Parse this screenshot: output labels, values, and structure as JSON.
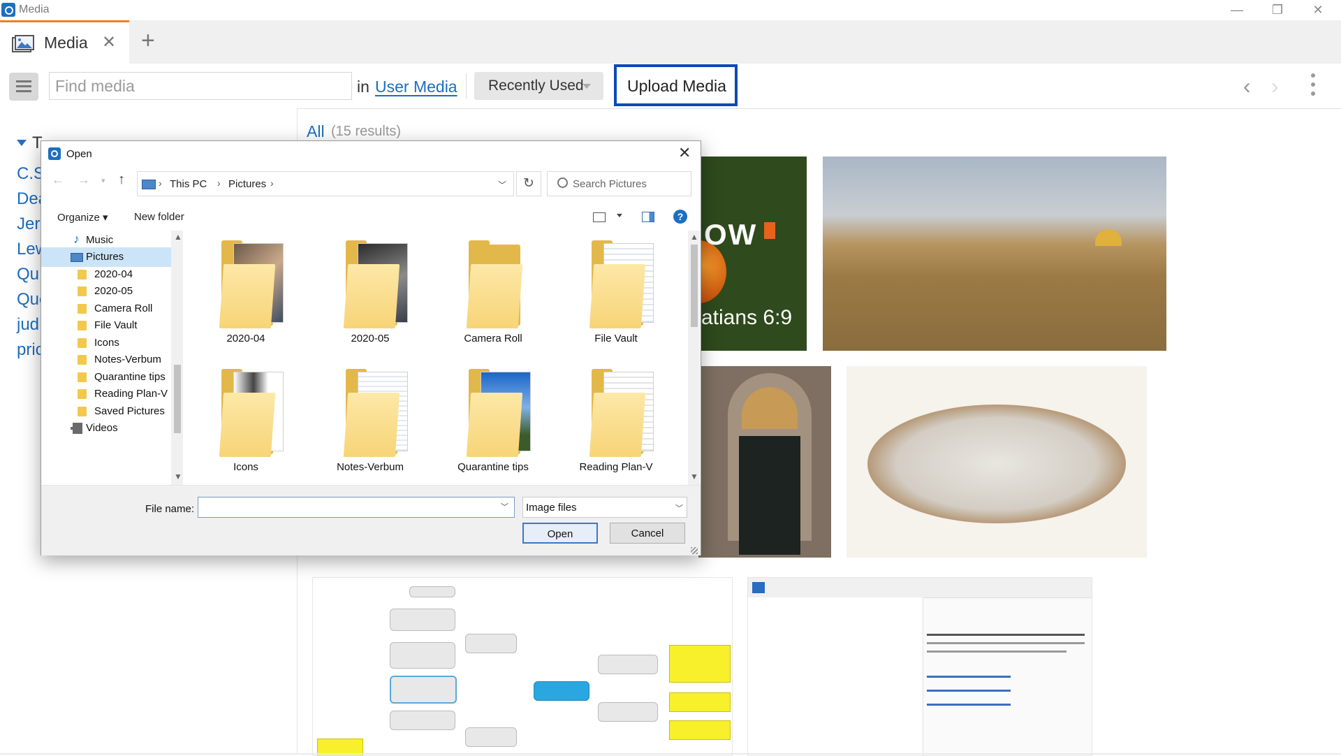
{
  "window": {
    "title": "Media",
    "minimize": "—",
    "restore": "❐",
    "close": "✕"
  },
  "tabs": {
    "active_label": "Media",
    "close_glyph": "✕",
    "add_glyph": "+"
  },
  "toolbar": {
    "search_placeholder": "Find media",
    "search_value": "",
    "in_label": "in",
    "scope": "User Media",
    "sort_label": "Recently Used",
    "upload_label": "Upload Media",
    "nav_back": "‹",
    "nav_forward": "›"
  },
  "sidebar": {
    "header_visible": "T",
    "items": [
      "C.S",
      "Dea",
      "Jer",
      "Lew",
      "Qu",
      "Quo",
      "jud",
      "pric"
    ]
  },
  "results": {
    "filter": "All",
    "count_text": "(15 results)"
  },
  "thumbnails": {
    "card1_text_big": "OW",
    "card1_text_ref": "atians 6:9"
  },
  "dialog": {
    "title": "Open",
    "close_glyph": "✕",
    "breadcrumb": [
      "This PC",
      "Pictures"
    ],
    "search_placeholder": "Search Pictures",
    "organize_label": "Organize ▾",
    "new_folder_label": "New folder",
    "help_glyph": "?",
    "nav_tree": [
      {
        "label": "Music",
        "kind": "music"
      },
      {
        "label": "Pictures",
        "kind": "pictures",
        "selected": true
      },
      {
        "label": "2020-04",
        "kind": "folder"
      },
      {
        "label": "2020-05",
        "kind": "folder"
      },
      {
        "label": "Camera Roll",
        "kind": "folder"
      },
      {
        "label": "File Vault",
        "kind": "folder"
      },
      {
        "label": "Icons",
        "kind": "folder"
      },
      {
        "label": "Notes-Verbum",
        "kind": "folder"
      },
      {
        "label": "Quarantine tips",
        "kind": "folder"
      },
      {
        "label": "Reading Plan-V",
        "kind": "folder"
      },
      {
        "label": "Saved Pictures",
        "kind": "folder"
      },
      {
        "label": "Videos",
        "kind": "videos"
      }
    ],
    "folders": [
      "2020-04",
      "2020-05",
      "Camera Roll",
      "File Vault",
      "Icons",
      "Notes-Verbum",
      "Quarantine tips",
      "Reading Plan-V"
    ],
    "file_name_label": "File name:",
    "file_name_value": "",
    "file_type": "Image files",
    "open_label": "Open",
    "cancel_label": "Cancel"
  },
  "colors": {
    "accent_blue": "#1b6ec2",
    "upload_border": "#0a4bb5",
    "tab_accent": "#f07f22",
    "selection": "#cce4f7"
  }
}
